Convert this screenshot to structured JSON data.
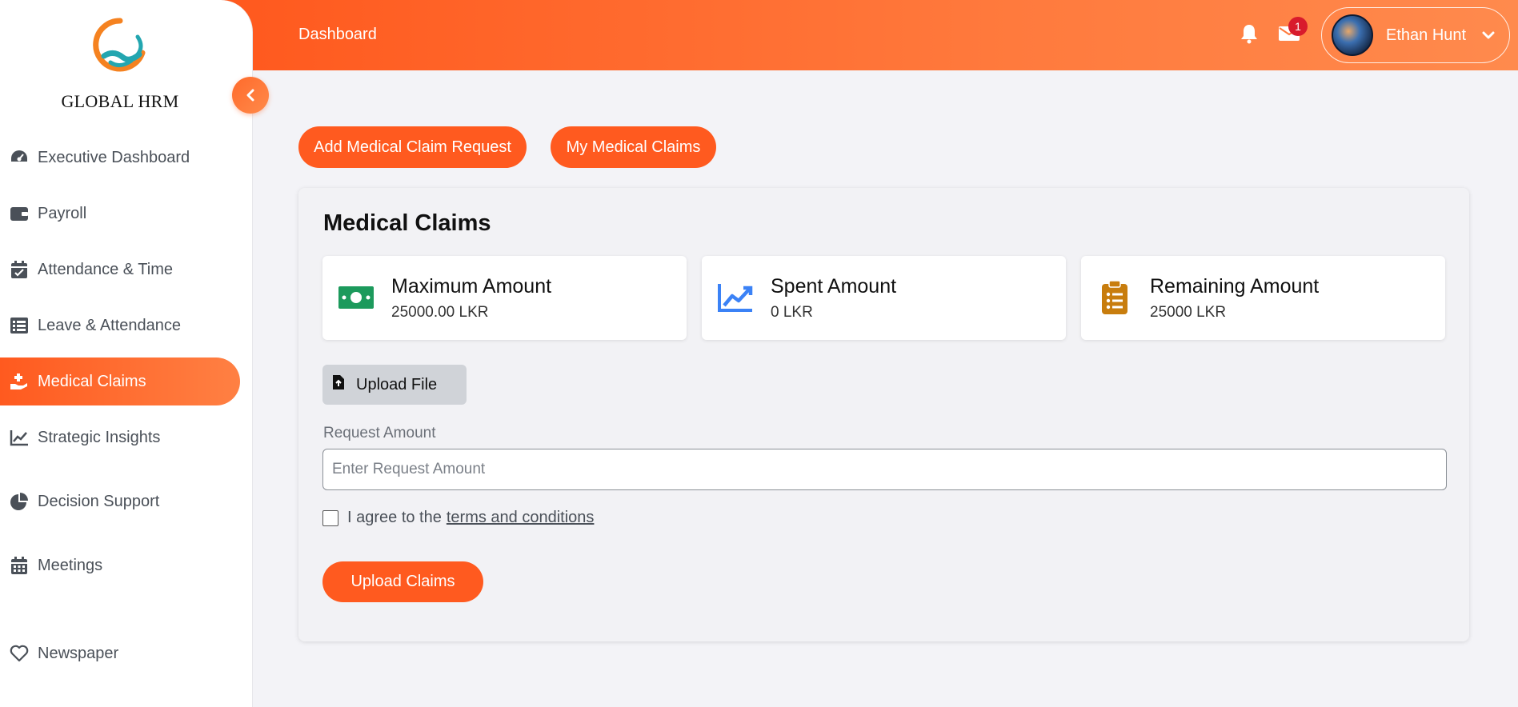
{
  "brand": {
    "name": "GLOBAL HRM",
    "logo_icon": "handshake-logo"
  },
  "sidebar": {
    "items": [
      {
        "label": "Executive Dashboard",
        "icon": "gauge-icon",
        "active": false
      },
      {
        "label": "Payroll",
        "icon": "wallet-icon",
        "active": false
      },
      {
        "label": "Attendance & Time",
        "icon": "calendar-check-icon",
        "active": false
      },
      {
        "label": "Leave & Attendance",
        "icon": "list-icon",
        "active": false
      },
      {
        "label": "Medical Claims",
        "icon": "hand-medical-icon",
        "active": true
      },
      {
        "label": "Strategic Insights",
        "icon": "chart-line-icon",
        "active": false
      },
      {
        "label": "Decision Support",
        "icon": "chart-pie-icon",
        "active": false
      },
      {
        "label": "Meetings",
        "icon": "calendar-icon",
        "active": false
      },
      {
        "label": "Newspaper",
        "icon": "heart-icon",
        "active": false
      }
    ]
  },
  "header": {
    "title": "Dashboard",
    "notifications_icon": "bell-icon",
    "mail_icon": "envelope-icon",
    "mail_badge": "1",
    "user": {
      "name": "Ethan Hunt",
      "avatar": "avatar"
    }
  },
  "actions": {
    "add_claim_label": "Add Medical Claim Request",
    "my_claims_label": "My Medical Claims"
  },
  "claims": {
    "title": "Medical Claims",
    "stats": [
      {
        "label": "Maximum Amount",
        "value": "25000.00 LKR",
        "icon": "money-bill-icon",
        "color": "#1c9a5c"
      },
      {
        "label": "Spent Amount",
        "value": "0 LKR",
        "icon": "chart-line-icon",
        "color": "#3b82f6"
      },
      {
        "label": "Remaining Amount",
        "value": "25000 LKR",
        "icon": "clipboard-list-icon",
        "color": "#c87d0e"
      }
    ],
    "upload_label": "Upload File",
    "request_label": "Request Amount",
    "request_placeholder": "Enter Request Amount",
    "request_value": "",
    "agree_text": "I agree to the",
    "terms_text": "terms and conditions",
    "agree_checked": false,
    "submit_label": "Upload Claims"
  },
  "colors": {
    "accent": "#ff5a1f",
    "sidebar_bg": "#ffffff",
    "page_bg": "#f3f3f7"
  }
}
